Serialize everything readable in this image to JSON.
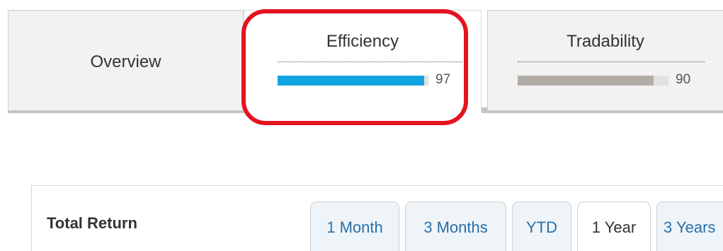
{
  "metric_tabs": [
    {
      "label": "Overview"
    },
    {
      "label": "Efficiency",
      "score": 97,
      "score_text": "97",
      "fill_color": "#12a3e0"
    },
    {
      "label": "Tradability",
      "score": 90,
      "score_text": "90",
      "fill_color": "#b1aca6"
    }
  ],
  "colors": {
    "highlight": "#e3141f",
    "link": "#2a6fa8"
  },
  "total_return": {
    "title": "Total Return",
    "periods": [
      {
        "label": "1 Month"
      },
      {
        "label": "3 Months"
      },
      {
        "label": "YTD"
      },
      {
        "label": "1 Year",
        "selected": true
      },
      {
        "label": "3 Years"
      }
    ]
  }
}
